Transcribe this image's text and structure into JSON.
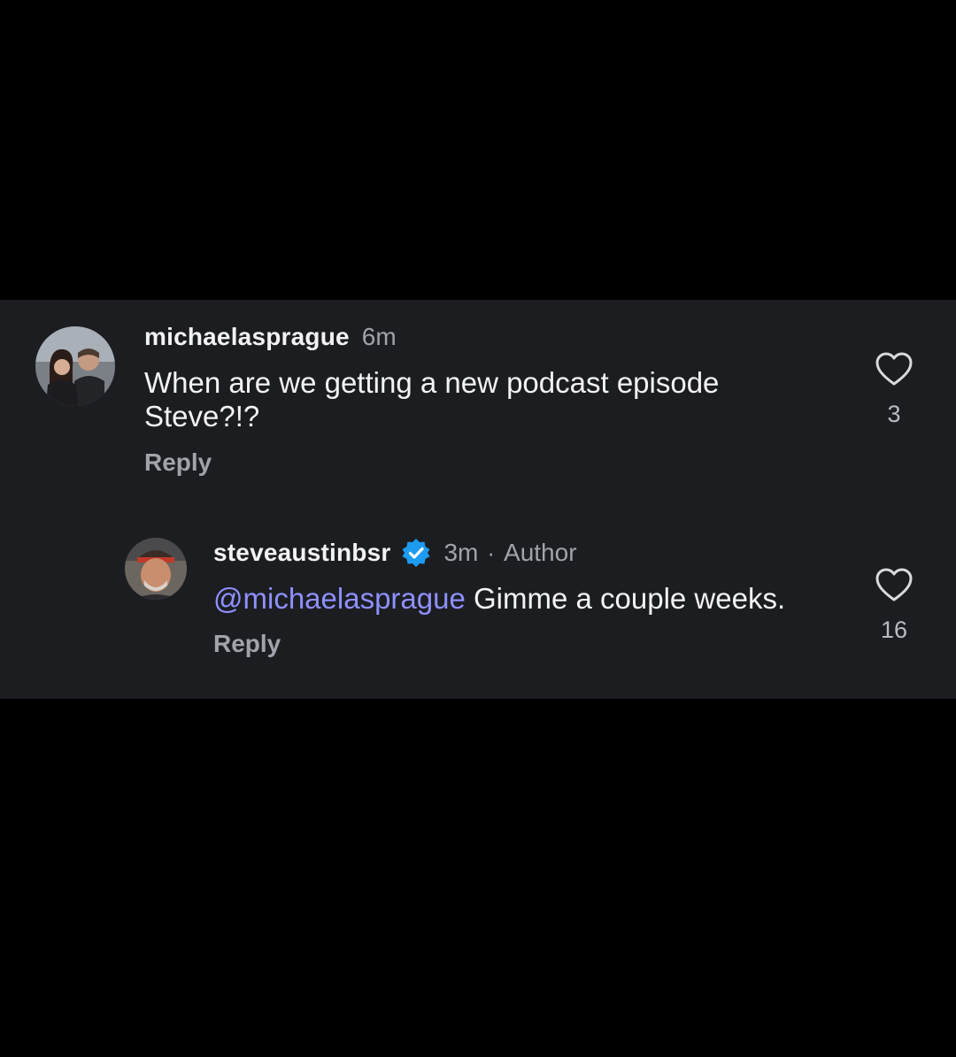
{
  "comments": [
    {
      "username": "michaelasprague",
      "time": "6m",
      "text": "When are we getting a new podcast episode Steve?!?",
      "reply_label": "Reply",
      "like_count": "3"
    },
    {
      "username": "steveaustinbsr",
      "time": "3m",
      "separator": "·",
      "author_label": "Author",
      "mention": "@michaelasprague",
      "text": "Gimme a couple weeks.",
      "reply_label": "Reply",
      "like_count": "16"
    }
  ],
  "icons": {
    "like": "heart-outline-icon",
    "verified": "verified-badge-icon"
  },
  "colors": {
    "background": "#000000",
    "panel": "#1b1d21",
    "mention": "#8f90ff",
    "verified": "#1d9bf0",
    "muted_text": "#a0a4aa"
  }
}
